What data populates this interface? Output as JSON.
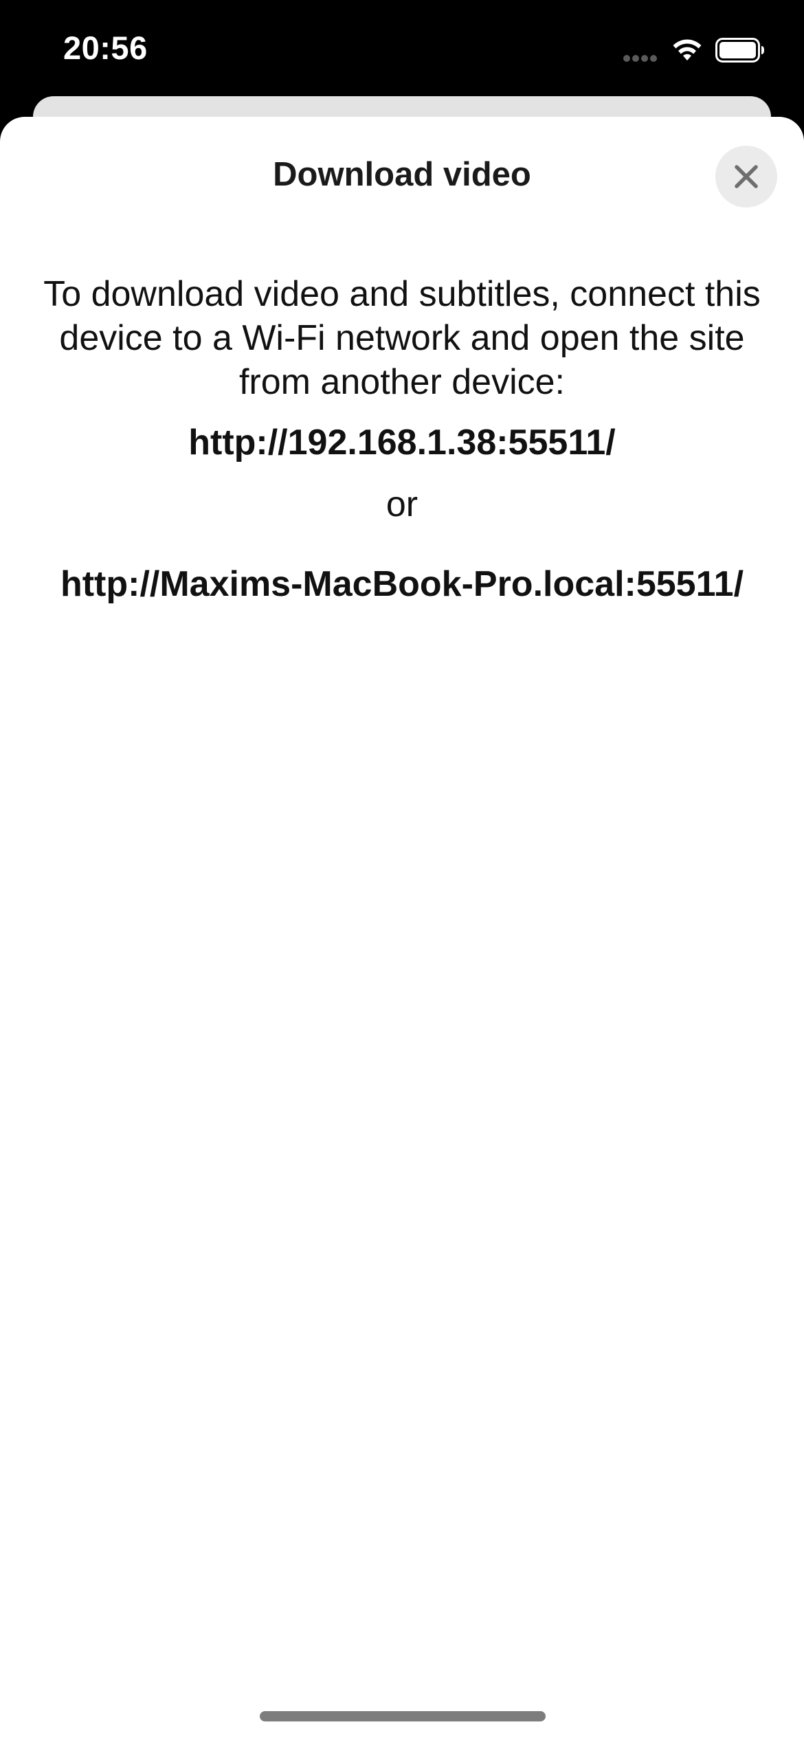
{
  "status_bar": {
    "time": "20:56",
    "icons": [
      "signal-icon",
      "wifi-icon",
      "battery-icon"
    ]
  },
  "sheet": {
    "title": "Download video",
    "close_icon": "close-icon"
  },
  "content": {
    "description": "To download video and subtitles, connect this device to a Wi-Fi network and open the site from another device:",
    "url_primary": "http://192.168.1.38:55511/",
    "or_label": "or",
    "url_secondary": "http://Maxims-MacBook-Pro.local:55511/"
  },
  "colors": {
    "background": "#000000",
    "sheet": "#ffffff",
    "close_button_bg": "#ebebeb",
    "text": "#111111"
  }
}
